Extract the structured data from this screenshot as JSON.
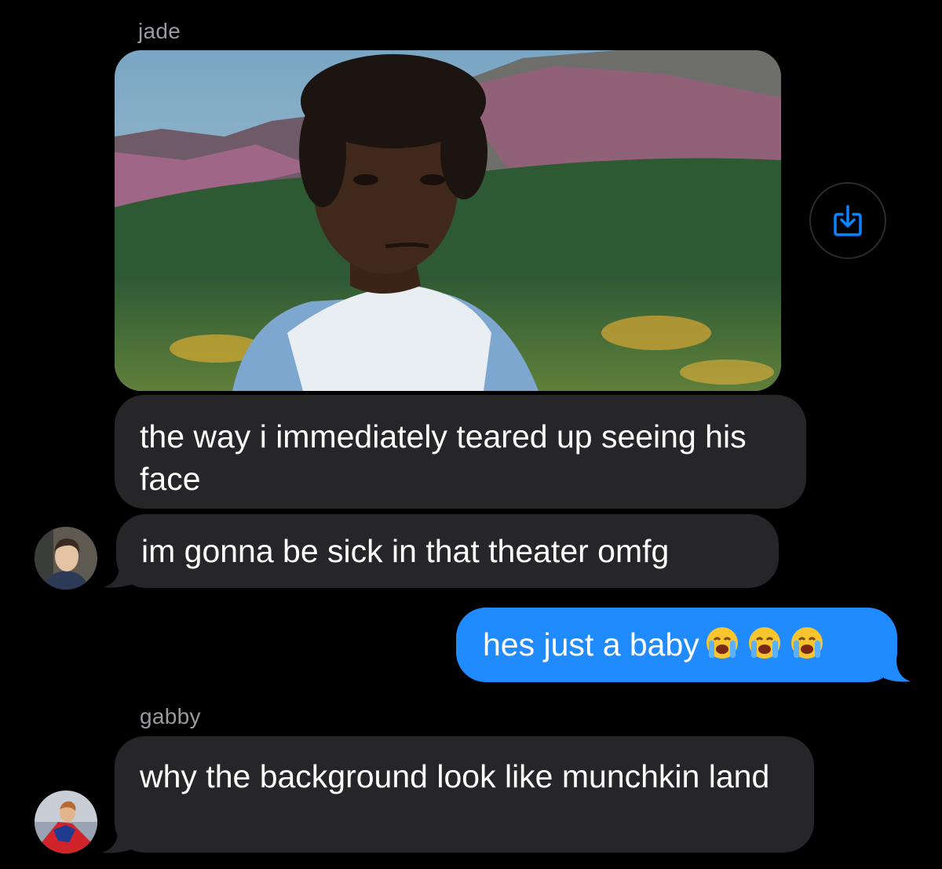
{
  "conversation": {
    "groups": [
      {
        "sender": "jade",
        "messages": [
          {
            "type": "image",
            "description": "movie still attachment"
          },
          {
            "type": "text",
            "text": "the way i immediately teared up seeing his face"
          },
          {
            "type": "text",
            "text": "im gonna be sick in that theater omfg"
          }
        ]
      },
      {
        "sender": "me",
        "messages": [
          {
            "type": "text",
            "text": "hes just a baby",
            "emoji": [
              "crying-face",
              "crying-face",
              "crying-face"
            ]
          }
        ]
      },
      {
        "sender": "gabby",
        "messages": [
          {
            "type": "text",
            "text": "why the background look like munchkin land"
          }
        ]
      }
    ]
  },
  "icons": {
    "save_button": "save-download-icon"
  },
  "colors": {
    "background": "#000000",
    "incoming_bubble": "#262629",
    "outgoing_bubble": "#1f8bff",
    "sender_label": "#9a9a9f",
    "accent": "#0a84ff"
  }
}
